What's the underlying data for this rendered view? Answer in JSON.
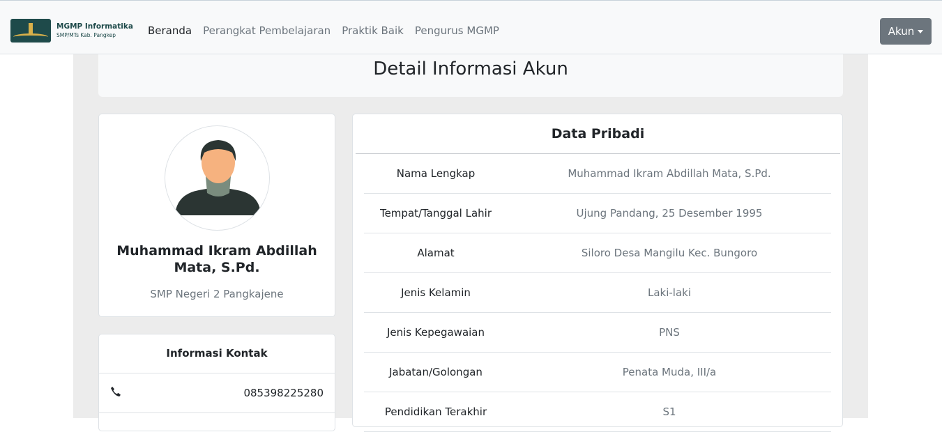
{
  "brand": {
    "title": "MGMP Informatika",
    "subtitle": "SMP/MTs Kab. Pangkep"
  },
  "nav": {
    "items": [
      {
        "label": "Beranda",
        "active": true
      },
      {
        "label": "Perangkat Pembelajaran",
        "active": false
      },
      {
        "label": "Praktik Baik",
        "active": false
      },
      {
        "label": "Pengurus MGMP",
        "active": false
      }
    ],
    "account_label": "Akun"
  },
  "page": {
    "title": "Detail Informasi Akun"
  },
  "profile": {
    "name": "Muhammad Ikram Abdillah Mata, S.Pd.",
    "school": "SMP Negeri 2 Pangkajene",
    "avatar_icon": "user-avatar-icon"
  },
  "contact": {
    "title": "Informasi Kontak",
    "phone_icon": "phone-icon",
    "phone": "085398225280"
  },
  "personal": {
    "title": "Data Pribadi",
    "rows": [
      {
        "label": "Nama Lengkap",
        "value": "Muhammad Ikram Abdillah Mata, S.Pd."
      },
      {
        "label": "Tempat/Tanggal Lahir",
        "value": "Ujung Pandang, 25 Desember 1995"
      },
      {
        "label": "Alamat",
        "value": "Siloro Desa Mangilu Kec. Bungoro"
      },
      {
        "label": "Jenis Kelamin",
        "value": "Laki-laki"
      },
      {
        "label": "Jenis Kepegawaian",
        "value": "PNS"
      },
      {
        "label": "Jabatan/Golongan",
        "value": "Penata Muda, III/a"
      },
      {
        "label": "Pendidikan Terakhir",
        "value": "S1"
      }
    ]
  },
  "colors": {
    "navbar_bg": "#f8f9fa",
    "account_button": "#6c757d",
    "brand": "#1e4a4a",
    "muted_text": "#6c757d"
  }
}
